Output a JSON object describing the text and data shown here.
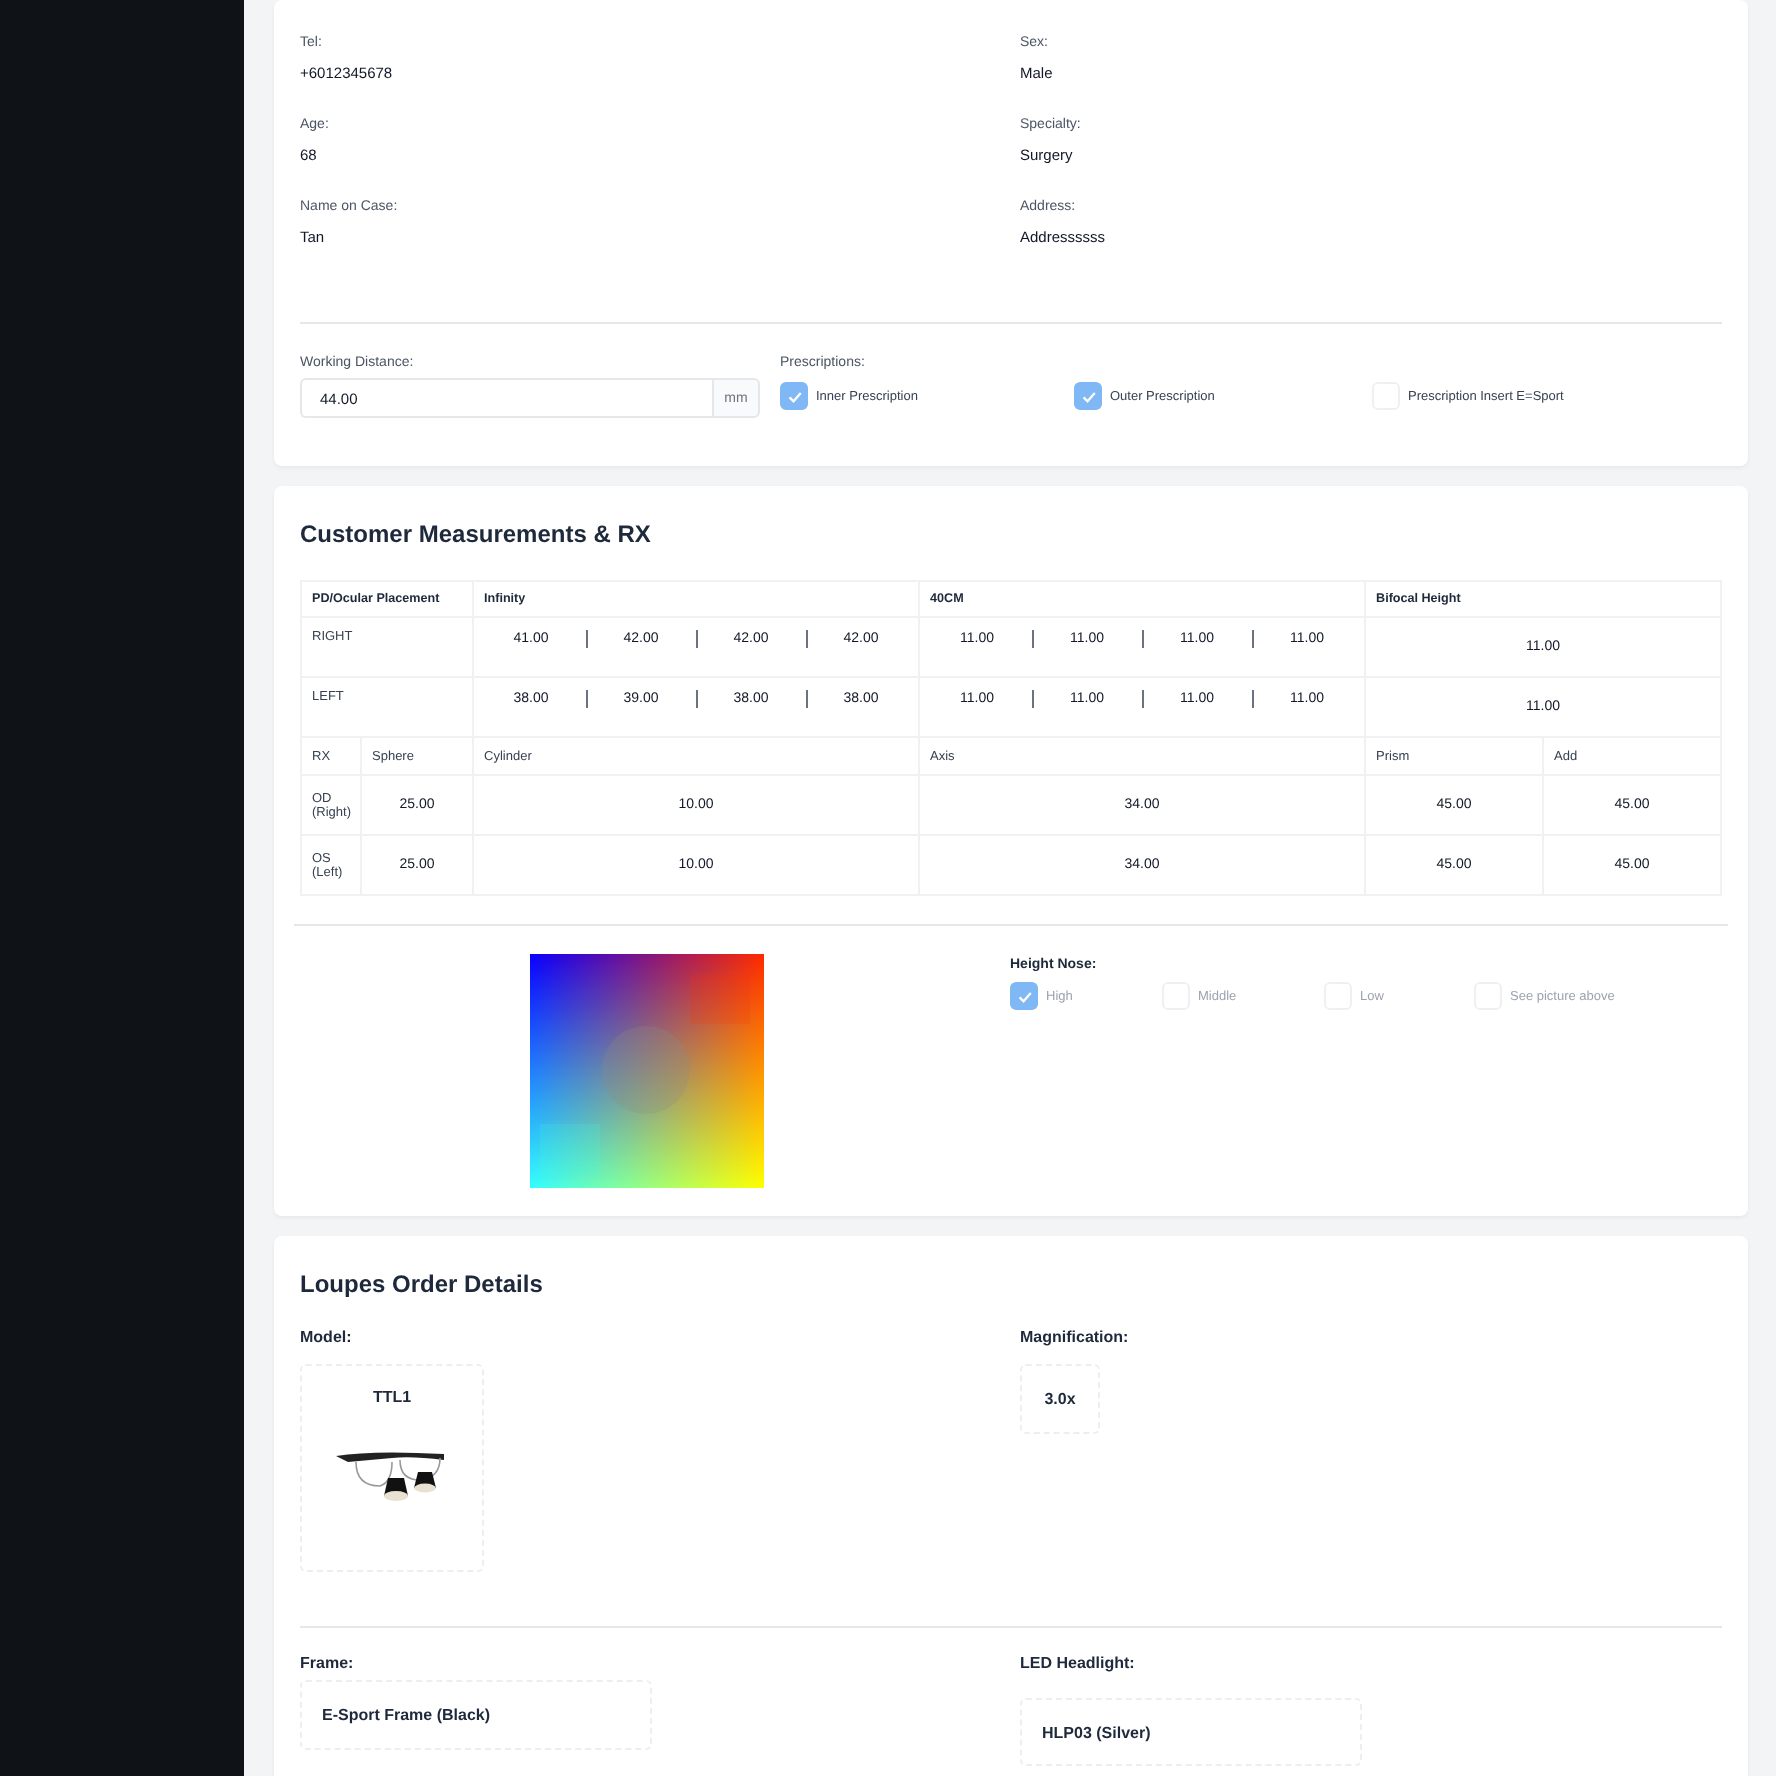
{
  "patient_fields": [
    {
      "label": "Tel:",
      "value": "+6012345678"
    },
    {
      "label": "Sex:",
      "value": "Male"
    },
    {
      "label": "Age:",
      "value": "68"
    },
    {
      "label": "Specialty:",
      "value": "Surgery"
    },
    {
      "label": "Name on Case:",
      "value": "Tan"
    },
    {
      "label": "Address:",
      "value": "Addressssss"
    }
  ],
  "working_distance": {
    "label": "Working Distance:",
    "value": "44.00",
    "unit": "mm"
  },
  "prescriptions": {
    "label": "Prescriptions:",
    "options": [
      {
        "label": "Inner Prescription",
        "checked": true
      },
      {
        "label": "Outer Prescription",
        "checked": true
      },
      {
        "label": "Prescription Insert E=Sport",
        "checked": false
      }
    ]
  },
  "measurements": {
    "title": "Customer Measurements & RX",
    "pd_header": [
      "PD/Ocular Placement",
      "Infinity",
      "40CM",
      "Bifocal Height"
    ],
    "pd_rows": [
      {
        "label": "RIGHT",
        "infinity": [
          "41.00",
          "42.00",
          "42.00",
          "42.00"
        ],
        "cm40": [
          "11.00",
          "11.00",
          "11.00",
          "11.00"
        ],
        "bifocal": "11.00"
      },
      {
        "label": "LEFT",
        "infinity": [
          "38.00",
          "39.00",
          "38.00",
          "38.00"
        ],
        "cm40": [
          "11.00",
          "11.00",
          "11.00",
          "11.00"
        ],
        "bifocal": "11.00"
      }
    ],
    "rx_header": [
      "RX",
      "Sphere",
      "Cylinder",
      "Axis",
      "Prism",
      "Add"
    ],
    "rx_rows": [
      {
        "label": "OD (Right)",
        "values": [
          "25.00",
          "10.00",
          "34.00",
          "45.00",
          "45.00"
        ]
      },
      {
        "label": "OS (Left)",
        "values": [
          "25.00",
          "10.00",
          "34.00",
          "45.00",
          "45.00"
        ]
      }
    ],
    "height_nose": {
      "label": "Height Nose:",
      "options": [
        {
          "label": "High",
          "checked": true
        },
        {
          "label": "Middle",
          "checked": false
        },
        {
          "label": "Low",
          "checked": false
        },
        {
          "label": "See picture above",
          "checked": false
        }
      ]
    }
  },
  "order": {
    "title": "Loupes Order Details",
    "model": {
      "label": "Model:",
      "value": "TTL1"
    },
    "magnification": {
      "label": "Magnification:",
      "value": "3.0x"
    },
    "frame": {
      "label": "Frame:",
      "value": "E-Sport Frame (Black)"
    },
    "led_headlight": {
      "label": "LED Headlight:",
      "value": "HLP03 (Silver)"
    }
  }
}
